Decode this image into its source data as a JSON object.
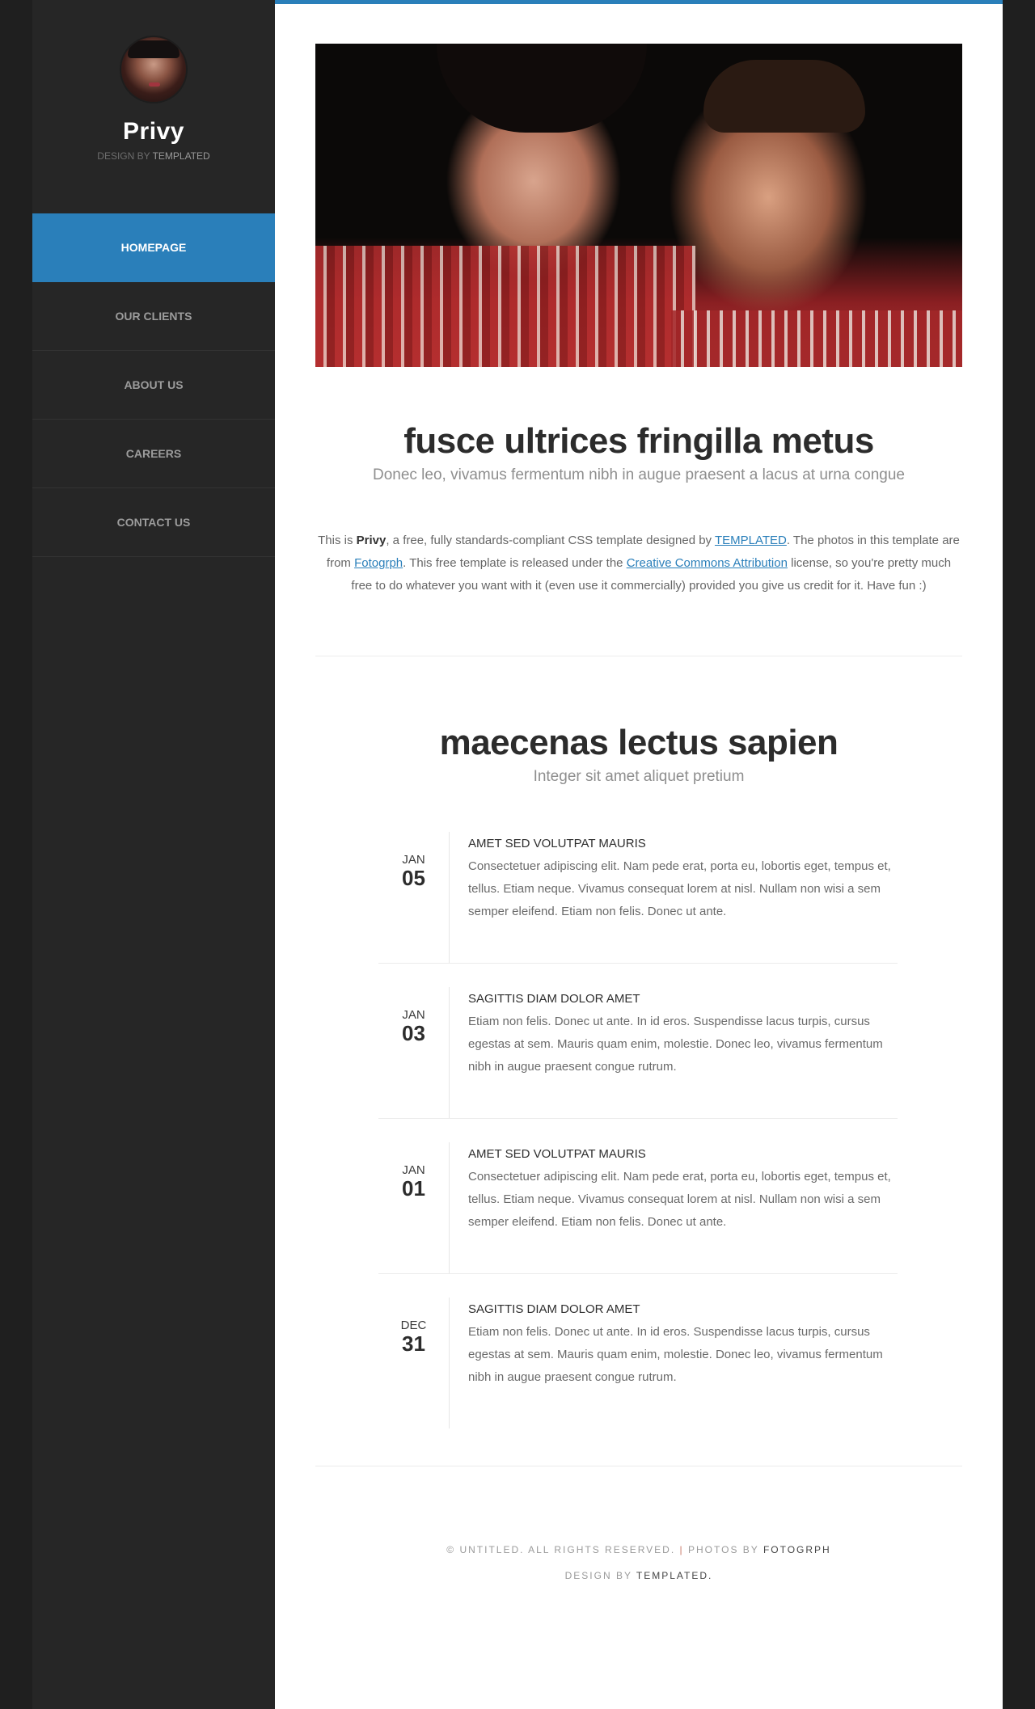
{
  "sidebar": {
    "title": "Privy",
    "credit_prefix": "Design by",
    "credit_link": "TEMPLATED",
    "nav": [
      {
        "label": "Homepage"
      },
      {
        "label": "Our Clients"
      },
      {
        "label": "About Us"
      },
      {
        "label": "Careers"
      },
      {
        "label": "Contact Us"
      }
    ]
  },
  "section1": {
    "title": "fusce ultrices fringilla metus",
    "subtitle": "Donec leo, vivamus fermentum nibh in augue praesent a lacus at urna congue",
    "intro": {
      "t1": "This is ",
      "brand": "Privy",
      "t2": ", a free, fully standards-compliant CSS template designed by ",
      "link1": "TEMPLATED",
      "t3": ". The photos in this template are from ",
      "link2": "Fotogrph",
      "t4": ". This free template is released under the ",
      "link3": "Creative Commons Attribution",
      "t5": " license, so you're pretty much free to do whatever you want with it (even use it commercially) provided you give us credit for it. Have fun :)"
    }
  },
  "section2": {
    "title": "maecenas lectus sapien",
    "subtitle": "Integer sit amet aliquet pretium"
  },
  "posts": [
    {
      "month": "Jan",
      "day": "05",
      "title": "Amet sed volutpat mauris",
      "text": "Consectetuer adipiscing elit. Nam pede erat, porta eu, lobortis eget, tempus et, tellus. Etiam neque. Vivamus consequat lorem at nisl. Nullam non wisi a sem semper eleifend. Etiam non felis. Donec ut ante."
    },
    {
      "month": "Jan",
      "day": "03",
      "title": "Sagittis diam dolor amet",
      "text": "Etiam non felis. Donec ut ante. In id eros. Suspendisse lacus turpis, cursus egestas at sem. Mauris quam enim, molestie. Donec leo, vivamus fermentum nibh in augue praesent congue rutrum."
    },
    {
      "month": "Jan",
      "day": "01",
      "title": "Amet sed volutpat mauris",
      "text": "Consectetuer adipiscing elit. Nam pede erat, porta eu, lobortis eget, tempus et, tellus. Etiam neque. Vivamus consequat lorem at nisl. Nullam non wisi a sem semper eleifend. Etiam non felis. Donec ut ante."
    },
    {
      "month": "Dec",
      "day": "31",
      "title": "Sagittis diam dolor amet",
      "text": "Etiam non felis. Donec ut ante. In id eros. Suspendisse lacus turpis, cursus egestas at sem. Mauris quam enim, molestie. Donec leo, vivamus fermentum nibh in augue praesent congue rutrum."
    }
  ],
  "footer": {
    "copyright": "© Untitled. All rights reserved.",
    "separator": "|",
    "photos_prefix": "Photos by",
    "photos_link": "Fotogrph",
    "design_prefix": "Design by",
    "design_link": "TEMPLATED."
  },
  "colors": {
    "accent": "#2a7fba",
    "sidebar_bg": "#262626",
    "page_bg": "#1f1f1f"
  }
}
